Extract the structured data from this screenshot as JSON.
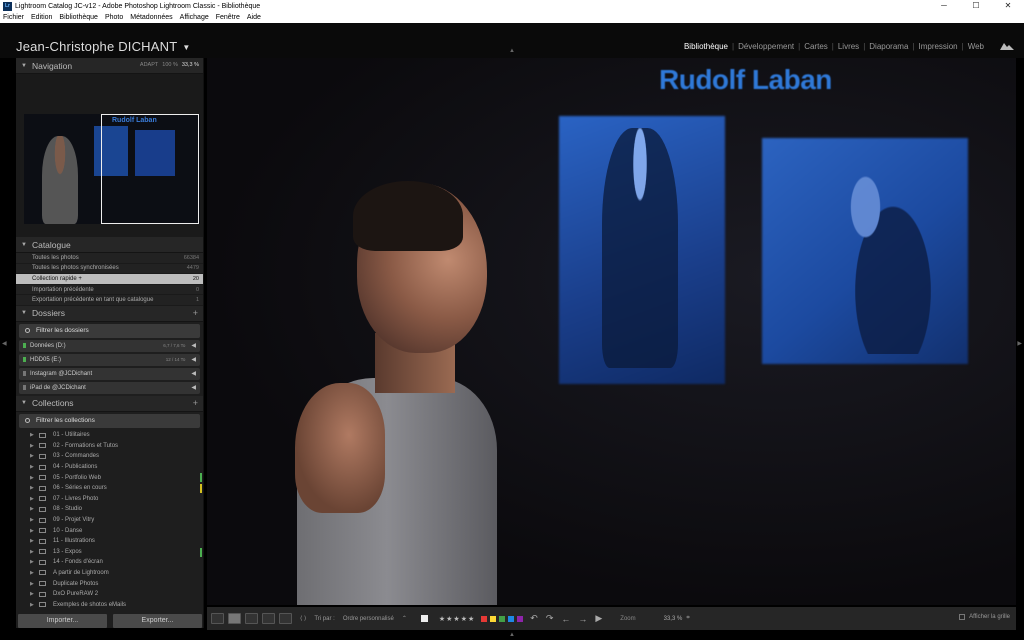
{
  "window": {
    "title": "Lightroom Catalog JC-v12 - Adobe Photoshop Lightroom Classic - Bibliothèque",
    "app_icon": "Lr",
    "controls": [
      "minimize-icon",
      "maximize-icon",
      "close-icon"
    ]
  },
  "menubar": [
    "Fichier",
    "Edition",
    "Bibliothèque",
    "Photo",
    "Métadonnées",
    "Affichage",
    "Fenêtre",
    "Aide"
  ],
  "identity_plate": "Jean-Christophe DICHANT",
  "modules": [
    "Bibliothèque",
    "Développement",
    "Cartes",
    "Livres",
    "Diaporama",
    "Impression",
    "Web"
  ],
  "active_module": "Bibliothèque",
  "navigator": {
    "title": "Navigation",
    "zoom_options": [
      "ADAPT",
      "100 %",
      "33,3 %"
    ],
    "zoom_selected": "33,3 %",
    "thumb_text": "Rudolf Laban"
  },
  "catalog": {
    "title": "Catalogue",
    "rows": [
      {
        "label": "Toutes les photos",
        "count": "66384"
      },
      {
        "label": "Toutes les photos synchronisées",
        "count": "4479"
      },
      {
        "label": "Collection rapide +",
        "count": "20"
      },
      {
        "label": "Importation précédente",
        "count": "0"
      },
      {
        "label": "Exportation précédente en tant que catalogue",
        "count": "1"
      }
    ]
  },
  "folders": {
    "title": "Dossiers",
    "filter_placeholder": "Filtrer les dossiers",
    "volumes": [
      {
        "name": "Données (D:)",
        "size": "6,7 / 7,6 To",
        "status": "online"
      },
      {
        "name": "HDD05 (E:)",
        "size": "12 / 14 To",
        "status": "online"
      },
      {
        "name": "Instagram @JCDichant",
        "size": "",
        "status": "none"
      },
      {
        "name": "iPad de @JCDichant",
        "size": "",
        "status": "none"
      }
    ]
  },
  "collections": {
    "title": "Collections",
    "filter_placeholder": "Filtrer les collections",
    "items": [
      {
        "label": "01 - Utilitaires",
        "mark": ""
      },
      {
        "label": "02 - Formations et Tutos",
        "mark": ""
      },
      {
        "label": "03 - Commandes",
        "mark": ""
      },
      {
        "label": "04 - Publications",
        "mark": ""
      },
      {
        "label": "05 - Portfolio Web",
        "mark": "#4caf50"
      },
      {
        "label": "06 - Séries en cours",
        "mark": "#d4c020"
      },
      {
        "label": "07 - Livres Photo",
        "mark": ""
      },
      {
        "label": "08 - Studio",
        "mark": ""
      },
      {
        "label": "09 - Projet Vitry",
        "mark": ""
      },
      {
        "label": "10 - Danse",
        "mark": ""
      },
      {
        "label": "11 - Illustrations",
        "mark": ""
      },
      {
        "label": "13 - Expos",
        "mark": "#4caf50"
      },
      {
        "label": "14 - Fonds d'écran",
        "mark": ""
      },
      {
        "label": "A partir de Lightroom",
        "mark": ""
      },
      {
        "label": "Duplicate Photos",
        "mark": ""
      },
      {
        "label": "DxO PureRAW 2",
        "mark": ""
      },
      {
        "label": "Exemples de shotos eMails",
        "mark": ""
      }
    ]
  },
  "left_buttons": {
    "import": "Importer...",
    "export": "Exporter..."
  },
  "image": {
    "screen_title": "Rudolf Laban"
  },
  "toolbar": {
    "sort_label": "Tri par :",
    "sort_value": "Ordre personnalisé",
    "stars": "★★★★★",
    "color_labels": [
      "#e53935",
      "#fdd835",
      "#43a047",
      "#1e88e5",
      "#8e24aa"
    ],
    "zoom_label": "Zoom",
    "zoom_value": "33,3 %",
    "grid_label": "Afficher la grille"
  }
}
